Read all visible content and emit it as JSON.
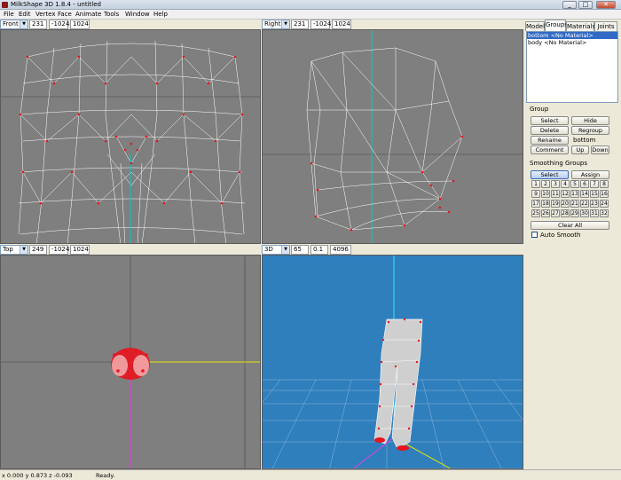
{
  "window": {
    "title": "MilkShape 3D 1.8.4 - untitled",
    "min": "_",
    "max": "□",
    "close": "✕"
  },
  "menu": [
    "File",
    "Edit",
    "Vertex",
    "Face",
    "Animate",
    "Tools",
    "Window",
    "Help"
  ],
  "viewports": {
    "front": {
      "view": "Front",
      "v1": "231",
      "v2": "-1024",
      "v3": "1024"
    },
    "right": {
      "view": "Right",
      "v1": "231",
      "v2": "-1024",
      "v3": "1024"
    },
    "top": {
      "view": "Top",
      "v1": "249",
      "v2": "-1024",
      "v3": "1024"
    },
    "persp": {
      "view": "3D",
      "v1": "65",
      "v2": "0.1",
      "v3": "4096"
    }
  },
  "panel": {
    "tabs": [
      "Model",
      "Groups",
      "Materials",
      "Joints"
    ],
    "active_tab": "Groups",
    "groups": [
      "bottom <No Material>",
      "body <No Material>"
    ],
    "group_section": "Group",
    "buttons": {
      "select": "Select",
      "hide": "Hide",
      "delete": "Delete",
      "regroup": "Regroup",
      "rename": "Rename",
      "comment": "Comment",
      "up": "Up",
      "down": "Down"
    },
    "rename_value": "bottom",
    "smoothing_section": "Smoothing Groups",
    "sg_select": "Select",
    "sg_assign": "Assign",
    "numbers": [
      "1",
      "2",
      "3",
      "4",
      "5",
      "6",
      "7",
      "8",
      "9",
      "10",
      "11",
      "12",
      "13",
      "14",
      "15",
      "16",
      "17",
      "18",
      "19",
      "20",
      "21",
      "22",
      "23",
      "24",
      "25",
      "26",
      "27",
      "28",
      "29",
      "30",
      "31",
      "32"
    ],
    "clear_all": "Clear All",
    "auto_smooth": "Auto Smooth"
  },
  "status": {
    "coords": "x 0.000 y 0.873 z -0.093",
    "message": "Ready."
  },
  "colors": {
    "viewport_bg": "#7f7f7f",
    "persp_bg": "#2f7fbd",
    "vertex": "#e8141e",
    "wire": "#ffffff",
    "selection": "#316ac5"
  }
}
